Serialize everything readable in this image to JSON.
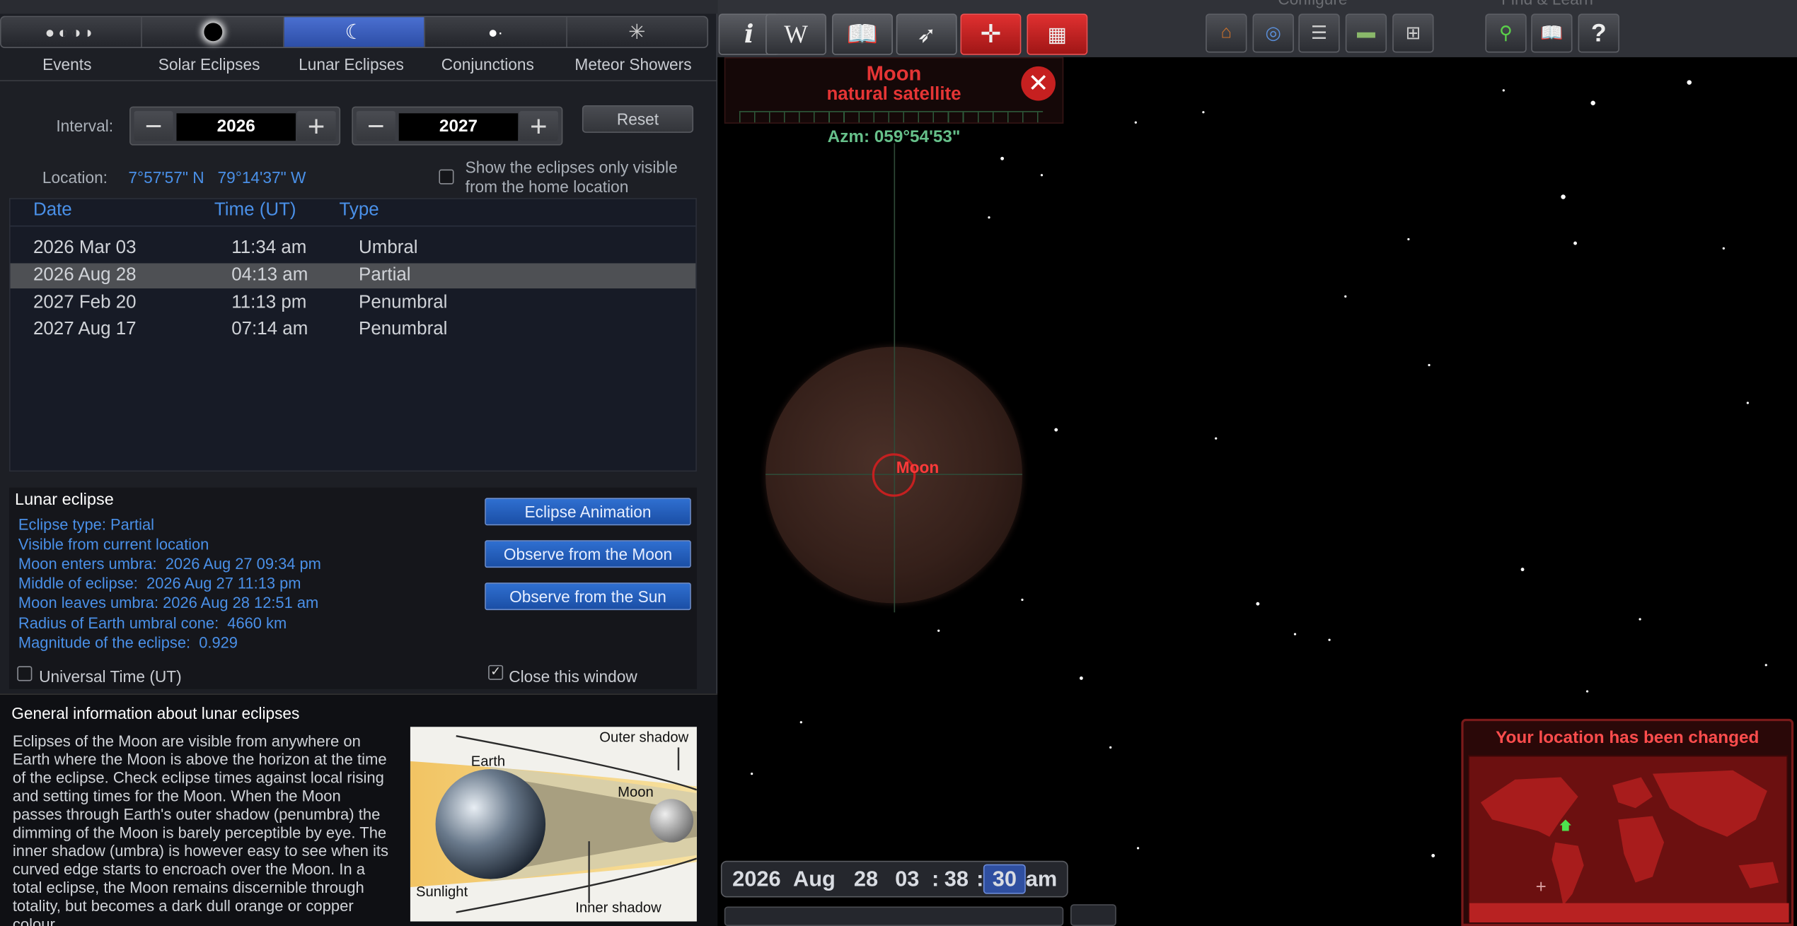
{
  "tabs": [
    {
      "label": "Events",
      "icon": "events-phases-icon"
    },
    {
      "label": "Solar Eclipses",
      "icon": "solar-eclipse-icon"
    },
    {
      "label": "Lunar Eclipses",
      "icon": "lunar-eclipse-icon"
    },
    {
      "label": "Conjunctions",
      "icon": "conjunction-icon"
    },
    {
      "label": "Meteor Showers",
      "icon": "meteor-shower-icon"
    }
  ],
  "interval": {
    "label": "Interval:",
    "from": "2026",
    "to": "2027",
    "minus": "−",
    "plus": "+",
    "reset": "Reset"
  },
  "location": {
    "label": "Location:",
    "value": "7°57'57\" N   79°14'37\" W",
    "home_only_line1": "Show the eclipses only visible",
    "home_only_line2": "from the home location"
  },
  "table": {
    "headers": {
      "date": "Date",
      "time": "Time (UT)",
      "type": "Type"
    },
    "rows": [
      {
        "date": "2026 Mar 03",
        "time": "11:34 am",
        "type": "Umbral"
      },
      {
        "date": "2026 Aug 28",
        "time": "04:13 am",
        "type": "Partial"
      },
      {
        "date": "2027 Feb 20",
        "time": "11:13 pm",
        "type": "Penumbral"
      },
      {
        "date": "2027 Aug 17",
        "time": "07:14 am",
        "type": "Penumbral"
      }
    ]
  },
  "details": {
    "title": "Lunar eclipse",
    "lines": [
      "Eclipse type: Partial",
      "Visible from current location",
      "Moon enters umbra:  2026 Aug 27 09:34 pm",
      "Middle of eclipse:  2026 Aug 27 11:13 pm",
      "Moon leaves umbra: 2026 Aug 28 12:51 am",
      "Radius of Earth umbral cone:  4660 km",
      "Magnitude of the eclipse:  0.929"
    ],
    "buttons": [
      "Eclipse Animation",
      "Observe from the Moon",
      "Observe from the Sun"
    ],
    "ut_label": "Universal Time (UT)",
    "close_label": "Close this window"
  },
  "general": {
    "title": "General information about lunar eclipses",
    "text": "Eclipses of the Moon are visible from anywhere on Earth where the Moon is above the horizon at the time of the eclipse. Check eclipse times against local rising and setting times for the Moon. When the Moon passes through Earth's outer shadow (penumbra) the dimming of the Moon is barely perceptible by eye. The inner shadow (umbra) is however easy to see when its curved edge starts to encroach over the Moon. In a total eclipse, the Moon remains discernible through totality, but becomes a dark dull orange or copper colour.",
    "diagram": {
      "earth": "Earth",
      "moon": "Moon",
      "outer": "Outer shadow",
      "inner": "Inner shadow",
      "sunlight": "Sunlight"
    }
  },
  "toolbar": {
    "left_icons": [
      "info-icon",
      "wikipedia-icon",
      "book-icon",
      "rocket-icon",
      "target-icon",
      "calendar-icon"
    ],
    "info": "i",
    "wiki": "W",
    "configure_label": "Configure",
    "find_label": "Find & Learn",
    "right_icons": [
      "home-icon",
      "grid-icon",
      "sliders-icon",
      "landscape-icon",
      "add-window-icon",
      "search-icon",
      "book-icon",
      "help-icon"
    ],
    "help": "?"
  },
  "object": {
    "name": "Moon",
    "type": "natural satellite",
    "azimuth": "Azm: 059°54'53\"",
    "label": "Moon"
  },
  "datetime": {
    "year": "2026",
    "month": "Aug",
    "day": "28",
    "hour": "03",
    "sep1": ":",
    "minute": "38",
    "sep2": ":",
    "second": "30",
    "ampm": "am"
  },
  "location_notice": {
    "title": "Your location has been changed"
  },
  "colors": {
    "accent": "#4a90e8",
    "selection": "#4e5054",
    "alert": "#e03030",
    "notice_title": "#ff4d4d"
  }
}
